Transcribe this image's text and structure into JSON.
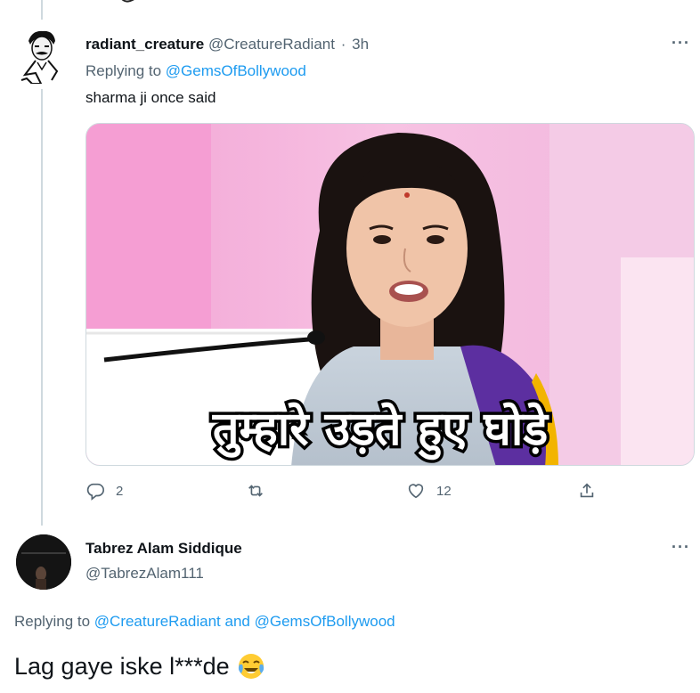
{
  "tweet1": {
    "display_name": "radiant_creature",
    "handle": "@CreatureRadiant",
    "separator": "·",
    "time": "3h",
    "more": "···",
    "replying_prefix": "Replying to ",
    "replying_to": "@GemsOfBollywood",
    "text": "sharma ji once said",
    "media_caption": "तुम्हारे उड़ते हुए घोड़े",
    "actions": {
      "reply_count": "2",
      "retweet_count": "",
      "like_count": "12"
    }
  },
  "tweet2": {
    "display_name": "Tabrez Alam Siddique",
    "handle": "@TabrezAlam111",
    "more": "···",
    "replying_prefix": "Replying to ",
    "replying_to_1": "@CreatureRadiant",
    "replying_and": " and ",
    "replying_to_2": "@GemsOfBollywood",
    "text": "Lag gaye iske l***de"
  },
  "icons": {
    "reply": "reply-icon",
    "retweet": "retweet-icon",
    "like": "heart-icon",
    "share": "share-icon",
    "emoji": "face-with-tears-of-joy-icon"
  },
  "colors": {
    "link": "#1d9bf0",
    "secondary_text": "#536471",
    "primary_text": "#0f1419",
    "thread_line": "#cfd9de"
  }
}
